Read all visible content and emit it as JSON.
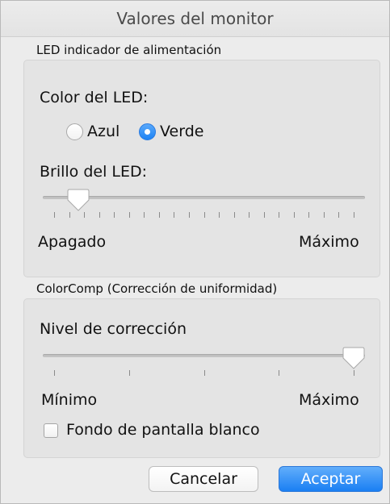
{
  "window": {
    "title": "Valores del monitor"
  },
  "led_group": {
    "title": "LED indicador de alimentación",
    "color_label": "Color del LED:",
    "options": [
      {
        "label": "Azul",
        "selected": false
      },
      {
        "label": "Verde",
        "selected": true
      }
    ],
    "brightness_label": "Brillo del LED:",
    "brightness_level": 0.08,
    "min_label": "Apagado",
    "max_label": "Máximo"
  },
  "colorcomp_group": {
    "title": "ColorComp (Corrección de uniformidad)",
    "level_label": "Nivel de corrección",
    "level": 1.0,
    "min_label": "Mínimo",
    "max_label": "Máximo",
    "checkbox_label": "Fondo de pantalla blanco",
    "checkbox_checked": false
  },
  "buttons": {
    "cancel": "Cancelar",
    "accept": "Aceptar"
  },
  "colors": {
    "accent": "#1d83f4"
  }
}
